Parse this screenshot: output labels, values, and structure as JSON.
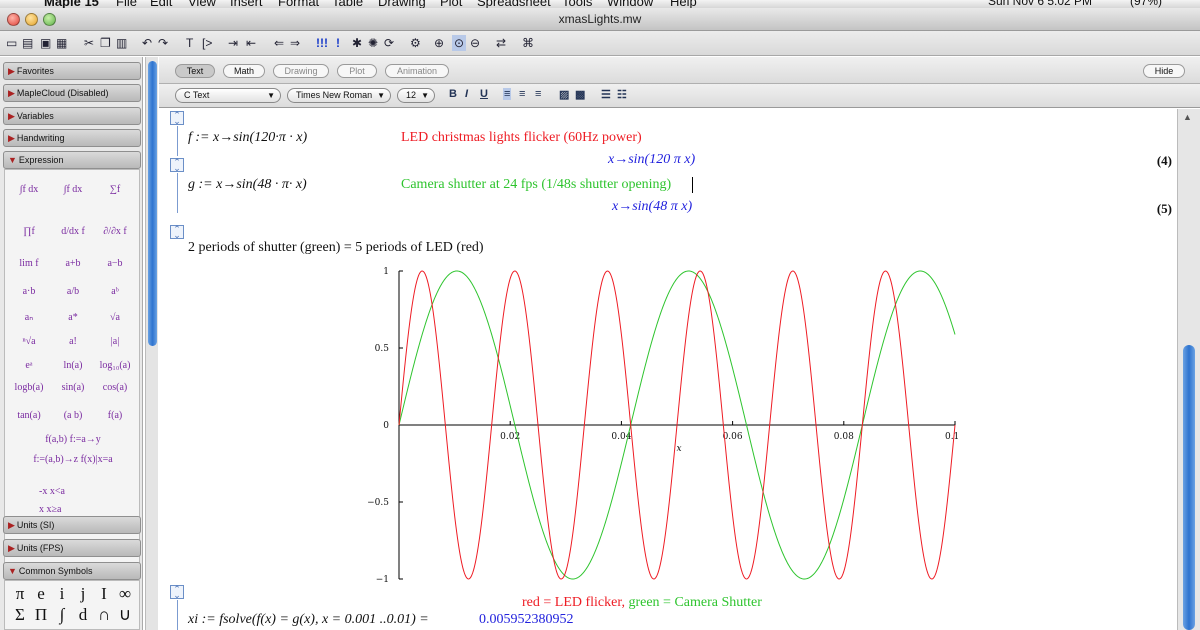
{
  "menubar": {
    "app": "Maple 15",
    "items": [
      "File",
      "Edit",
      "View",
      "Insert",
      "Format",
      "Table",
      "Drawing",
      "Plot",
      "Spreadsheet",
      "Tools",
      "Window",
      "Help"
    ],
    "clock": "Sun Nov 6  5:02 PM",
    "battery": "(97%)"
  },
  "window": {
    "title": "xmasLights.mw"
  },
  "palettes": {
    "headers_top": [
      "Favorites",
      "MapleCloud (Disabled)",
      "Variables",
      "Handwriting",
      "Expression"
    ],
    "headers_bottom": [
      "Units (SI)",
      "Units (FPS)",
      "Common Symbols"
    ],
    "expression_items": [
      "∫f dx",
      "∫f dx",
      "∑f",
      "∏f",
      "d/dx f",
      "∂/∂x f",
      "lim f",
      "a+b",
      "a−b",
      "a·b",
      "a/b",
      "aᵇ",
      "aₙ",
      "a*",
      "√a",
      "ⁿ√a",
      "a!",
      "|a|",
      "eᵃ",
      "ln(a)",
      "log₁₀(a)",
      "logb(a)",
      "sin(a)",
      "cos(a)",
      "tan(a)",
      "(a b)",
      "f(a)",
      "f(a,b)  f:=a→y",
      "f:=(a,b)→z  f(x)|x=a",
      "-x  x<a",
      "x  x≥a"
    ],
    "symbols_row1": [
      "π",
      "e",
      "i",
      "j",
      "I",
      "∞"
    ],
    "symbols_row2": [
      "Σ",
      "Π",
      "∫",
      "d",
      "∩",
      "∪"
    ]
  },
  "modebar": {
    "modes": [
      "Text",
      "Math",
      "Drawing",
      "Plot",
      "Animation"
    ],
    "hide_label": "Hide"
  },
  "formatbar": {
    "style": "C Text",
    "font": "Times New Roman",
    "size": "12",
    "bold": "B",
    "italic": "I",
    "underline": "U"
  },
  "document": {
    "line1_input": "f := x→sin(120·π · x)",
    "line1_comment": "LED christmas lights flicker (60Hz power)",
    "line1_output": "x→sin(120 π x)",
    "line1_eq": "(4)",
    "line2_input": "g := x→sin(48 · π· x)",
    "line2_comment": "Camera shutter at 24 fps (1/48s shutter opening)",
    "line2_output": "x→sin(48 π x)",
    "line2_eq": "(5)",
    "plot_caption": "2 periods of shutter (green) = 5 periods of LED (red)",
    "legend_red": "red = LED flicker,",
    "legend_green": "green = Camera Shutter",
    "line3_input": "xi := fsolve(f(x) = g(x), x = 0.001 ..0.01) =",
    "line3_output": "0.005952380952"
  },
  "colors": {
    "red": "#ee1c24",
    "green": "#2ec42e",
    "mathblue": "#2222dd"
  },
  "chart_data": {
    "type": "line",
    "xlabel": "x",
    "ylabel": "",
    "xlim": [
      0,
      0.1
    ],
    "ylim": [
      -1,
      1
    ],
    "x_ticks": [
      "0.02",
      "0.04",
      "0.06",
      "0.08",
      "0.10"
    ],
    "y_ticks": [
      "1",
      "0.5",
      "0",
      "−0.5",
      "−1"
    ],
    "grid": false,
    "series": [
      {
        "name": "LED flicker",
        "expr": "sin(120 π x)",
        "color": "#ee1c24",
        "x": [
          0,
          0.004167,
          0.008333,
          0.0125,
          0.016667,
          0.020833,
          0.025,
          0.029167,
          0.033333,
          0.0375,
          0.041667,
          0.045833,
          0.05,
          0.054167,
          0.058333,
          0.0625,
          0.066667,
          0.070833,
          0.075,
          0.079167,
          0.083333,
          0.0875,
          0.091667,
          0.095833,
          0.1
        ],
        "y": [
          0,
          1,
          0,
          -1,
          0,
          1,
          0,
          -1,
          0,
          1,
          0,
          -1,
          0,
          1,
          0,
          -1,
          0,
          1,
          0,
          -1,
          0,
          1,
          0,
          -1,
          0
        ]
      },
      {
        "name": "Camera Shutter",
        "expr": "sin(48 π x)",
        "color": "#2ec42e",
        "x": [
          0,
          0.010417,
          0.020833,
          0.03125,
          0.041667,
          0.052083,
          0.0625,
          0.072917,
          0.083333,
          0.09375,
          0.1
        ],
        "y": [
          0,
          1,
          0,
          -1,
          0,
          1,
          0,
          -1,
          0,
          1,
          0.588
        ]
      }
    ]
  }
}
